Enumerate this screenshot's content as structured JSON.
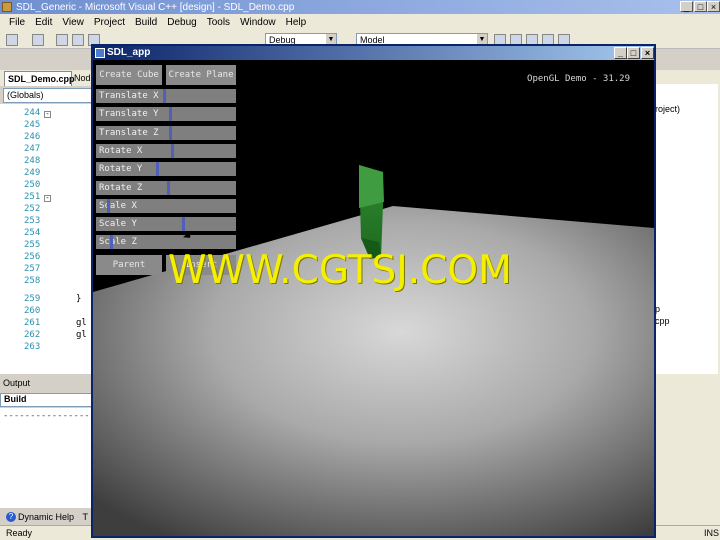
{
  "app_title": "SDL_Generic - Microsoft Visual C++ [design] - SDL_Demo.cpp",
  "menu": [
    "File",
    "Edit",
    "View",
    "Project",
    "Build",
    "Debug",
    "Tools",
    "Window",
    "Help"
  ],
  "toolbar": {
    "config": "Debug",
    "target": "Model"
  },
  "editor": {
    "tab_active": "SDL_Demo.cpp",
    "tab_other": "Nod",
    "scope_combo": "(Globals)",
    "lines": [
      {
        "n": "244",
        "code": ""
      },
      {
        "n": "245",
        "code": ""
      },
      {
        "n": "246",
        "code": ""
      },
      {
        "n": "247",
        "code": ""
      },
      {
        "n": "248",
        "code": ""
      },
      {
        "n": "249",
        "code": ""
      },
      {
        "n": "250",
        "code": ""
      },
      {
        "n": "251",
        "code": ""
      },
      {
        "n": "252",
        "code": ""
      },
      {
        "n": "253",
        "code": ""
      },
      {
        "n": "254",
        "code": ""
      },
      {
        "n": "255",
        "code": ""
      },
      {
        "n": "256",
        "code": ""
      },
      {
        "n": "257",
        "code": ""
      },
      {
        "n": "258",
        "code": ""
      },
      {
        "n": "259",
        "code": "}"
      },
      {
        "n": "260",
        "code": ""
      },
      {
        "n": "261",
        "code": "gl"
      },
      {
        "n": "262",
        "code": "gl"
      },
      {
        "n": "263",
        "code": ""
      }
    ]
  },
  "output": {
    "title": "Output",
    "combo": "Build",
    "text": "------------------"
  },
  "dynamic_help": "Dynamic Help",
  "dynamic_help_2": "T",
  "status": {
    "left": "Ready",
    "right": "INS"
  },
  "right_panel": {
    "line1": "roject)",
    "line2": "p",
    "line3": "cpp"
  },
  "sdl": {
    "title": "SDL_app",
    "fps_label": "OpenGL Demo - 31.29",
    "create_cube": "Create Cube",
    "create_plane": "Create Plane",
    "sliders": [
      {
        "label": "Translate X",
        "value": 0.49
      },
      {
        "label": "Translate Y",
        "value": 0.53
      },
      {
        "label": "Translate Z",
        "value": 0.53
      },
      {
        "label": "Rotate X",
        "value": 0.55
      },
      {
        "label": "Rotate Y",
        "value": 0.44
      },
      {
        "label": "Rotate Z",
        "value": 0.52
      },
      {
        "label": "Scale X",
        "value": 0.08
      },
      {
        "label": "Scale Y",
        "value": 0.63
      },
      {
        "label": "Scale Z",
        "value": 0.1
      }
    ],
    "parent_button": "Parent",
    "second_button": "Insert"
  },
  "watermark": "WWW.CGTSJ.COM"
}
